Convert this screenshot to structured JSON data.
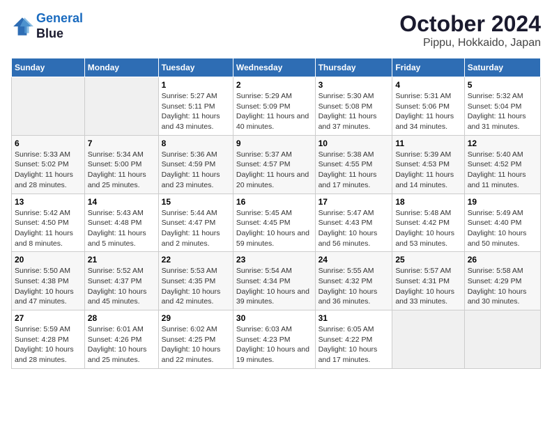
{
  "logo": {
    "line1": "General",
    "line2": "Blue"
  },
  "title": "October 2024",
  "subtitle": "Pippu, Hokkaido, Japan",
  "weekdays": [
    "Sunday",
    "Monday",
    "Tuesday",
    "Wednesday",
    "Thursday",
    "Friday",
    "Saturday"
  ],
  "weeks": [
    [
      {
        "day": "",
        "empty": true
      },
      {
        "day": "",
        "empty": true
      },
      {
        "day": "1",
        "sunrise": "Sunrise: 5:27 AM",
        "sunset": "Sunset: 5:11 PM",
        "daylight": "Daylight: 11 hours and 43 minutes."
      },
      {
        "day": "2",
        "sunrise": "Sunrise: 5:29 AM",
        "sunset": "Sunset: 5:09 PM",
        "daylight": "Daylight: 11 hours and 40 minutes."
      },
      {
        "day": "3",
        "sunrise": "Sunrise: 5:30 AM",
        "sunset": "Sunset: 5:08 PM",
        "daylight": "Daylight: 11 hours and 37 minutes."
      },
      {
        "day": "4",
        "sunrise": "Sunrise: 5:31 AM",
        "sunset": "Sunset: 5:06 PM",
        "daylight": "Daylight: 11 hours and 34 minutes."
      },
      {
        "day": "5",
        "sunrise": "Sunrise: 5:32 AM",
        "sunset": "Sunset: 5:04 PM",
        "daylight": "Daylight: 11 hours and 31 minutes."
      }
    ],
    [
      {
        "day": "6",
        "sunrise": "Sunrise: 5:33 AM",
        "sunset": "Sunset: 5:02 PM",
        "daylight": "Daylight: 11 hours and 28 minutes."
      },
      {
        "day": "7",
        "sunrise": "Sunrise: 5:34 AM",
        "sunset": "Sunset: 5:00 PM",
        "daylight": "Daylight: 11 hours and 25 minutes."
      },
      {
        "day": "8",
        "sunrise": "Sunrise: 5:36 AM",
        "sunset": "Sunset: 4:59 PM",
        "daylight": "Daylight: 11 hours and 23 minutes."
      },
      {
        "day": "9",
        "sunrise": "Sunrise: 5:37 AM",
        "sunset": "Sunset: 4:57 PM",
        "daylight": "Daylight: 11 hours and 20 minutes."
      },
      {
        "day": "10",
        "sunrise": "Sunrise: 5:38 AM",
        "sunset": "Sunset: 4:55 PM",
        "daylight": "Daylight: 11 hours and 17 minutes."
      },
      {
        "day": "11",
        "sunrise": "Sunrise: 5:39 AM",
        "sunset": "Sunset: 4:53 PM",
        "daylight": "Daylight: 11 hours and 14 minutes."
      },
      {
        "day": "12",
        "sunrise": "Sunrise: 5:40 AM",
        "sunset": "Sunset: 4:52 PM",
        "daylight": "Daylight: 11 hours and 11 minutes."
      }
    ],
    [
      {
        "day": "13",
        "sunrise": "Sunrise: 5:42 AM",
        "sunset": "Sunset: 4:50 PM",
        "daylight": "Daylight: 11 hours and 8 minutes."
      },
      {
        "day": "14",
        "sunrise": "Sunrise: 5:43 AM",
        "sunset": "Sunset: 4:48 PM",
        "daylight": "Daylight: 11 hours and 5 minutes."
      },
      {
        "day": "15",
        "sunrise": "Sunrise: 5:44 AM",
        "sunset": "Sunset: 4:47 PM",
        "daylight": "Daylight: 11 hours and 2 minutes."
      },
      {
        "day": "16",
        "sunrise": "Sunrise: 5:45 AM",
        "sunset": "Sunset: 4:45 PM",
        "daylight": "Daylight: 10 hours and 59 minutes."
      },
      {
        "day": "17",
        "sunrise": "Sunrise: 5:47 AM",
        "sunset": "Sunset: 4:43 PM",
        "daylight": "Daylight: 10 hours and 56 minutes."
      },
      {
        "day": "18",
        "sunrise": "Sunrise: 5:48 AM",
        "sunset": "Sunset: 4:42 PM",
        "daylight": "Daylight: 10 hours and 53 minutes."
      },
      {
        "day": "19",
        "sunrise": "Sunrise: 5:49 AM",
        "sunset": "Sunset: 4:40 PM",
        "daylight": "Daylight: 10 hours and 50 minutes."
      }
    ],
    [
      {
        "day": "20",
        "sunrise": "Sunrise: 5:50 AM",
        "sunset": "Sunset: 4:38 PM",
        "daylight": "Daylight: 10 hours and 47 minutes."
      },
      {
        "day": "21",
        "sunrise": "Sunrise: 5:52 AM",
        "sunset": "Sunset: 4:37 PM",
        "daylight": "Daylight: 10 hours and 45 minutes."
      },
      {
        "day": "22",
        "sunrise": "Sunrise: 5:53 AM",
        "sunset": "Sunset: 4:35 PM",
        "daylight": "Daylight: 10 hours and 42 minutes."
      },
      {
        "day": "23",
        "sunrise": "Sunrise: 5:54 AM",
        "sunset": "Sunset: 4:34 PM",
        "daylight": "Daylight: 10 hours and 39 minutes."
      },
      {
        "day": "24",
        "sunrise": "Sunrise: 5:55 AM",
        "sunset": "Sunset: 4:32 PM",
        "daylight": "Daylight: 10 hours and 36 minutes."
      },
      {
        "day": "25",
        "sunrise": "Sunrise: 5:57 AM",
        "sunset": "Sunset: 4:31 PM",
        "daylight": "Daylight: 10 hours and 33 minutes."
      },
      {
        "day": "26",
        "sunrise": "Sunrise: 5:58 AM",
        "sunset": "Sunset: 4:29 PM",
        "daylight": "Daylight: 10 hours and 30 minutes."
      }
    ],
    [
      {
        "day": "27",
        "sunrise": "Sunrise: 5:59 AM",
        "sunset": "Sunset: 4:28 PM",
        "daylight": "Daylight: 10 hours and 28 minutes."
      },
      {
        "day": "28",
        "sunrise": "Sunrise: 6:01 AM",
        "sunset": "Sunset: 4:26 PM",
        "daylight": "Daylight: 10 hours and 25 minutes."
      },
      {
        "day": "29",
        "sunrise": "Sunrise: 6:02 AM",
        "sunset": "Sunset: 4:25 PM",
        "daylight": "Daylight: 10 hours and 22 minutes."
      },
      {
        "day": "30",
        "sunrise": "Sunrise: 6:03 AM",
        "sunset": "Sunset: 4:23 PM",
        "daylight": "Daylight: 10 hours and 19 minutes."
      },
      {
        "day": "31",
        "sunrise": "Sunrise: 6:05 AM",
        "sunset": "Sunset: 4:22 PM",
        "daylight": "Daylight: 10 hours and 17 minutes."
      },
      {
        "day": "",
        "empty": true
      },
      {
        "day": "",
        "empty": true
      }
    ]
  ]
}
